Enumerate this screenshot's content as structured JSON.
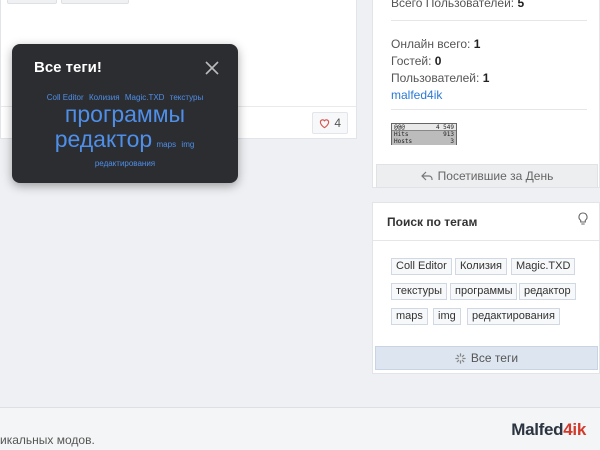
{
  "popup": {
    "title": "Все теги!",
    "cloud": {
      "row1": [
        "Coll Editor",
        "Колизия",
        "Magic.TXD",
        "текстуры"
      ],
      "big1": "программы",
      "big2": "редактор",
      "inline_small": [
        "maps",
        "img"
      ],
      "row4": "редактирования"
    }
  },
  "post": {
    "like_count": "4"
  },
  "stats": {
    "total_users_label": "Всего Пользователей:",
    "total_users_value": "5",
    "online_total_label": "Онлайн всего:",
    "online_total_value": "1",
    "guests_label": "Гостей:",
    "guests_value": "0",
    "users_label": "Пользователей:",
    "users_value": "1",
    "online_user": "malfed4ik",
    "counter": {
      "line1_left": "@@@",
      "line1_right": "4 549",
      "line2_left": "Hits",
      "line2_right": "913",
      "line3_left": "Hosts",
      "line3_right": "3"
    },
    "visitors_button": "Посетившие за День"
  },
  "tag_search": {
    "title": "Поиск по тегам",
    "tags": [
      "Coll Editor",
      "Колизия",
      "Magic.TXD",
      "текстуры",
      "программы",
      "редактор",
      "maps",
      "img",
      "редактирования"
    ],
    "all_tags_button": "Все теги"
  },
  "footer": {
    "text": "икальных модов.",
    "logo_main": "Malfed",
    "logo_accent": "4ik"
  },
  "colors": {
    "link": "#4f8fe8",
    "popup_bg": "#2b2d31",
    "like_heart": "#d9534f"
  }
}
